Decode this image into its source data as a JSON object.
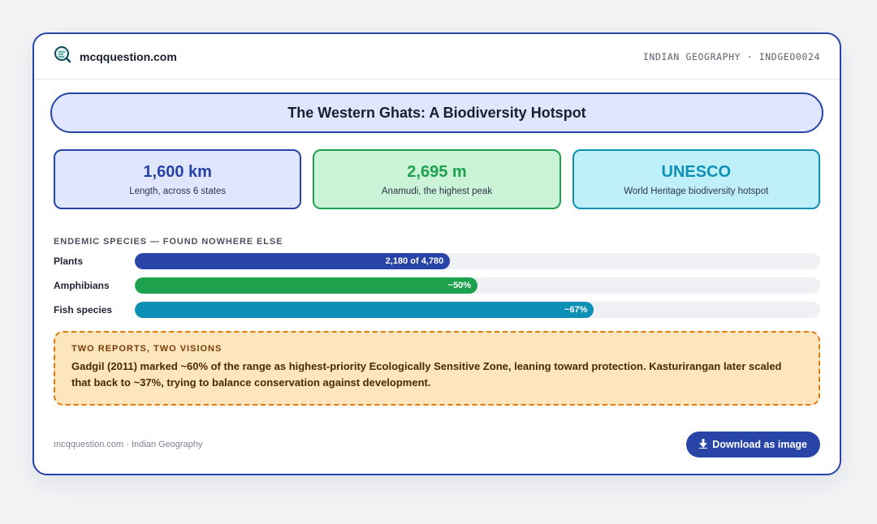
{
  "header": {
    "brand": "mcqquestion.com",
    "meta": "INDIAN GEOGRAPHY · INDGEO0024",
    "logo_icon": "magnifier-logo-icon"
  },
  "title": "The Western Ghats: A Biodiversity Hotspot",
  "stats": [
    {
      "value": "1,600 km",
      "label": "Length, across 6 states",
      "color": "#2744a6"
    },
    {
      "value": "2,695 m",
      "label": "Anamudi, the highest peak",
      "color": "#1da14d"
    },
    {
      "value": "UNESCO",
      "label": "World Heritage biodiversity hotspot",
      "color": "#0e8fb5"
    }
  ],
  "endemic": {
    "heading": "ENDEMIC SPECIES — FOUND NOWHERE ELSE",
    "rows": [
      {
        "label": "Plants",
        "text": "2,180 of 4,780",
        "percent": 46,
        "color": "#2744a6"
      },
      {
        "label": "Amphibians",
        "text": "~50%",
        "percent": 50,
        "color": "#1da14d"
      },
      {
        "label": "Fish species",
        "text": "~67%",
        "percent": 67,
        "color": "#0e8fb5"
      }
    ]
  },
  "callout": {
    "title": "TWO REPORTS, TWO VISIONS",
    "text": "Gadgil (2011) marked ~60% of the range as highest-priority Ecologically Sensitive Zone, leaning toward protection. Kasturirangan later scaled that back to ~37%, trying to balance conservation against development."
  },
  "footer": {
    "text": "mcqquestion.com · Indian Geography",
    "download_label": "Download as image",
    "download_icon": "download-arrow-icon"
  }
}
